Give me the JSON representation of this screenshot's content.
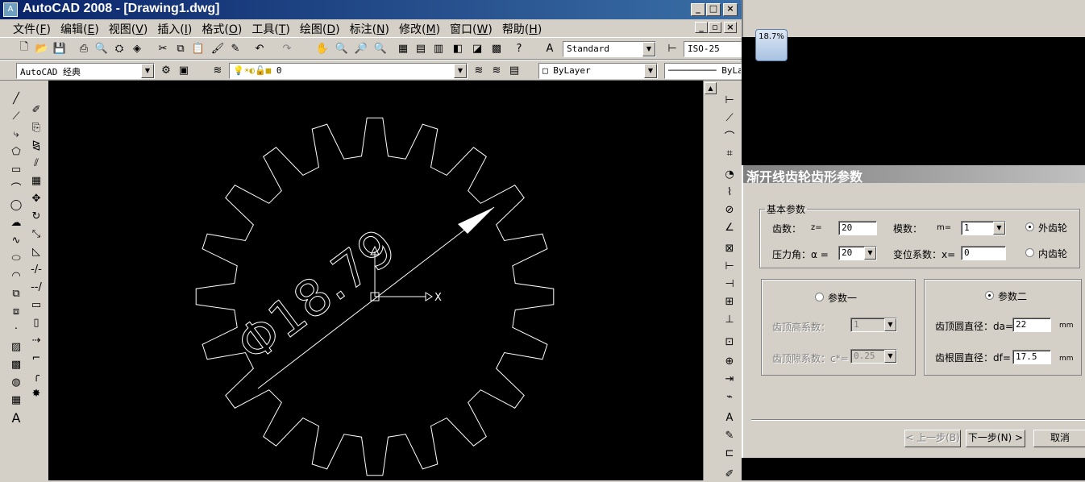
{
  "app": {
    "title": "AutoCAD 2008 - [Drawing1.dwg]",
    "icon_label": "A"
  },
  "menu": [
    {
      "label": "文件(",
      "acc": "F",
      "end": ")"
    },
    {
      "label": "编辑(",
      "acc": "E",
      "end": ")"
    },
    {
      "label": "视图(",
      "acc": "V",
      "end": ")"
    },
    {
      "label": "插入(",
      "acc": "I",
      "end": ")"
    },
    {
      "label": "格式(",
      "acc": "O",
      "end": ")"
    },
    {
      "label": "工具(",
      "acc": "T",
      "end": ")"
    },
    {
      "label": "绘图(",
      "acc": "D",
      "end": ")"
    },
    {
      "label": "标注(",
      "acc": "N",
      "end": ")"
    },
    {
      "label": "修改(",
      "acc": "M",
      "end": ")"
    },
    {
      "label": "窗口(",
      "acc": "W",
      "end": ")"
    },
    {
      "label": "帮助(",
      "acc": "H",
      "end": ")"
    }
  ],
  "toolbar": {
    "text_style": "Standard",
    "dim_style": "ISO-25",
    "workspace": "AutoCAD 经典",
    "layer": "0",
    "color": "ByLayer",
    "linetype": "ByLa"
  },
  "drawing": {
    "dimension_text": "Φ18.79",
    "ucs_x_label": "X",
    "colors": {
      "background": "#000000",
      "lines": "#ffffff"
    }
  },
  "overlay": {
    "percent": "18.7%"
  },
  "dialog": {
    "title": "渐开线齿轮齿形参数",
    "basic_group": "基本参数",
    "teeth_label": "齿数：",
    "teeth_var": "z=",
    "teeth_value": "20",
    "module_label": "模数：",
    "module_var": "m=",
    "module_value": "1",
    "external_gear": "外齿轮",
    "pressure_label": "压力角：α =",
    "pressure_value": "20",
    "shift_label": "变位系数：x=",
    "shift_value": "0",
    "internal_gear": "内齿轮",
    "option1": "参数一",
    "option2": "参数二",
    "addendum_coef_label": "齿顶高系数：",
    "addendum_coef_value": "1",
    "clearance_coef_label": "齿顶隙系数：c*=",
    "clearance_coef_value": "0.25",
    "tip_dia_label": "齿顶圆直径：da=",
    "tip_dia_value": "22",
    "root_dia_label": "齿根圆直径：df=",
    "root_dia_value": "17.5",
    "unit": "mm",
    "prev_button": "< 上一步(B)",
    "next_button": "下一步(N) >",
    "cancel_button": "取消"
  }
}
